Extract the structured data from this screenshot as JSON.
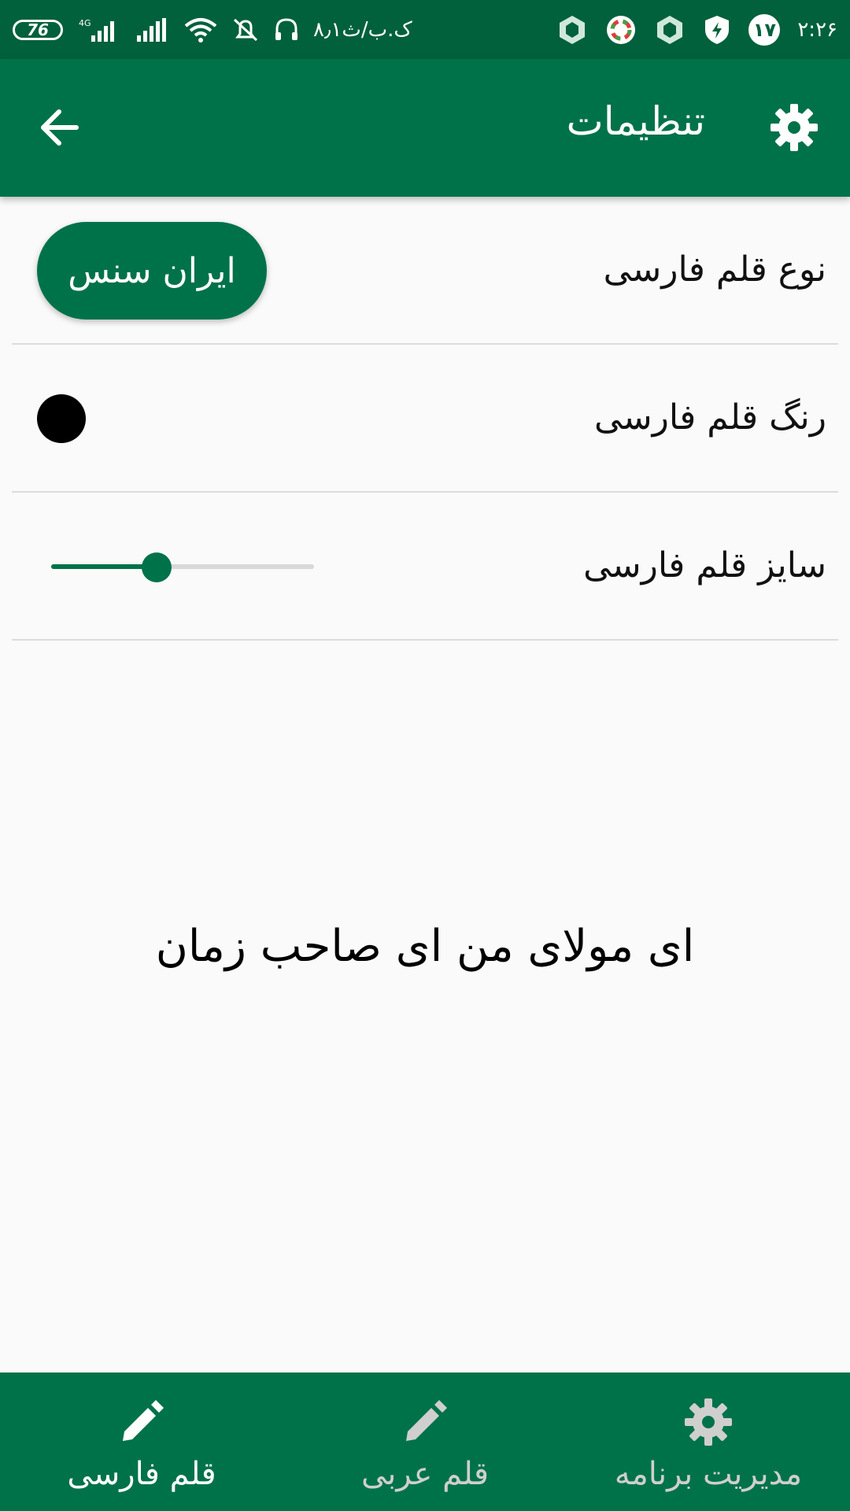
{
  "status_bar": {
    "battery": "76",
    "network_type": "4G",
    "speed": "۸٫۱ک.ب/ث",
    "notification_count": "۱۷",
    "time": "۲:۲۶"
  },
  "app_bar": {
    "title": "تنظیمات"
  },
  "settings": {
    "font_type": {
      "label": "نوع قلم فارسی",
      "value": "ایران سنس"
    },
    "font_color": {
      "label": "رنگ قلم فارسی",
      "color": "#000000"
    },
    "font_size": {
      "label": "سایز قلم فارسی",
      "slider_fraction": 0.4
    }
  },
  "preview": {
    "text": "ای مولای من ای صاحب زمان"
  },
  "bottom_nav": {
    "items": [
      {
        "label": "قلم فارسی",
        "icon": "pencil-icon",
        "active": true
      },
      {
        "label": "قلم عربی",
        "icon": "pencil-icon",
        "active": false
      },
      {
        "label": "مدیریت برنامه",
        "icon": "gear-icon",
        "active": false
      }
    ]
  },
  "colors": {
    "primary": "#00724a",
    "status_bar": "#00613c",
    "active_nav": "#ffffff",
    "inactive_nav": "#cfcfcf"
  }
}
